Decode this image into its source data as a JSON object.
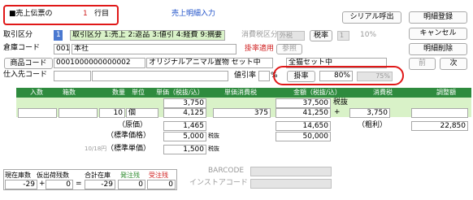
{
  "header": {
    "doc_label": "■売上伝票の",
    "doc_row_num": "1",
    "doc_row_suffix": "行目",
    "screen_title": "売上明細入力",
    "serial_button": "シリアル呼出",
    "detail_register_button": "明細登録",
    "cancel_button": "キャンセル",
    "detail_delete_button": "明細削除",
    "prev_button": "前",
    "next_button": "次"
  },
  "form": {
    "torihiki_label": "取引区分",
    "torihiki_value": "1",
    "torihiki_hint": "取引区分 1:売上 2:返品 3:値引 4:経費 9:摘要",
    "tax_kubun_label": "消費税区分",
    "tax_kubun_value": "外税",
    "tax_rate_button": "税率",
    "tax_rate_code": "1",
    "tax_rate_pct": "10%",
    "warehouse_label": "倉庫コード",
    "warehouse_code": "001",
    "warehouse_name": "本社",
    "tax_apply_label": "掛率適用",
    "reference_button": "参照",
    "product_code_button": "商品コード",
    "product_code": "0001000000000002",
    "product_name": "オリジナルアニマル置物 セット中",
    "product_name2": "全猫セット中",
    "supplier_label": "仕入先コード",
    "discount_label": "値引率",
    "discount_pct": "%",
    "kakeritsu_button": "掛率",
    "kakeritsu_value": "80%",
    "kakeritsu_value2": "75%"
  },
  "table": {
    "headers": {
      "nyusu": "入数",
      "hakosu": "箱数",
      "suryo": "数量",
      "tani": "単位",
      "tanka": "単価（税抜/込）",
      "tanka_tax": "単価消費税",
      "kingaku": "金額（税抜/込）",
      "shohizei": "消費税",
      "chosei": "調整額"
    },
    "row1": {
      "tanka": "3,750",
      "kingaku": "37,500",
      "zei_label": "税抜"
    },
    "row2": {
      "suryo": "10",
      "tani": "個",
      "tanka": "4,125",
      "tanka_tax": "375",
      "kingaku": "41,250",
      "plus": "+",
      "shohizei": "3,750"
    },
    "genka": {
      "label": "（原価）",
      "tanka": "1,465",
      "kingaku": "14,650",
      "arari_label": "（粗利）",
      "arari": "22,850"
    },
    "hyojun": {
      "label": "（標準価格）",
      "tanka": "5,000",
      "suffix": "税抜",
      "kingaku": "50,000"
    },
    "hyojun_tanka": {
      "prefix": "10/18円",
      "label": "（標準単価）",
      "tanka": "1,500",
      "suffix": "税抜"
    }
  },
  "stock": {
    "headers": {
      "zaiko": "現在庫数",
      "kari": "仮出荷残数",
      "gokei": "合計在庫",
      "hatchu": "発注残",
      "juchu": "受注残"
    },
    "values": {
      "zaiko": "-29",
      "plus": "+",
      "kari": "0",
      "eq": "=",
      "gokei": "-29",
      "hatchu": "0",
      "juchu": "0"
    }
  },
  "barcode": {
    "label": "BARCODE",
    "instore_label": "インストアコード"
  }
}
